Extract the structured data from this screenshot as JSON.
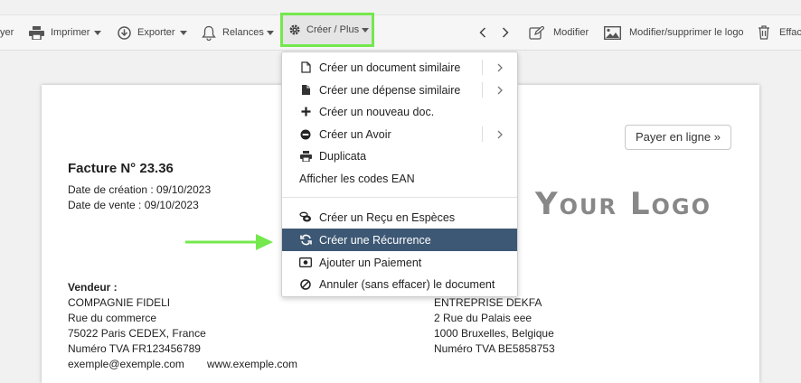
{
  "toolbar": {
    "payer_partial": "yer",
    "imprimer": "Imprimer",
    "exporter": "Exporter",
    "relances": "Relances",
    "creer_plus": "Créer / Plus",
    "modifier": "Modifier",
    "logo_action": "Modifier/supprimer le logo",
    "effacer_partial": "Effac"
  },
  "document": {
    "pay_online": "Payer en ligne »",
    "logo_text": "Your Logo",
    "invoice_title": "Facture N° 23.36",
    "creation_date": "Date de création : 09/10/2023",
    "sale_date": "Date de vente : 09/10/2023",
    "seller_label": "Vendeur :",
    "seller_lines": [
      "COMPAGNIE FIDELI",
      "Rue du commerce",
      "75022 Paris CEDEX, France",
      "Numéro TVA FR123456789"
    ],
    "seller_email": "exemple@exemple.com",
    "seller_web": "www.exemple.com",
    "buyer_lines": [
      "ENTREPRISE DEKFA",
      "2 Rue du Palais eee",
      "1000 Bruxelles, Belgique",
      "Numéro TVA BE5858753"
    ]
  },
  "menu": {
    "items": [
      {
        "label": "Créer un document similaire",
        "icon": "document-icon",
        "submenu": true
      },
      {
        "label": "Créer une dépense similaire",
        "icon": "document-filled-icon",
        "submenu": true
      },
      {
        "label": "Créer un nouveau doc.",
        "icon": "plus-icon",
        "submenu": false
      },
      {
        "label": "Créer un Avoir",
        "icon": "minus-circle-icon",
        "submenu": true
      },
      {
        "label": "Duplicata",
        "icon": "print-icon",
        "submenu": false
      },
      {
        "label": "Afficher les codes EAN",
        "icon": "",
        "submenu": false
      },
      {
        "label": "Créer un Reçu en Espèces",
        "icon": "coins-icon",
        "submenu": false
      },
      {
        "label": "Créer une Récurrence",
        "icon": "sync-icon",
        "submenu": false,
        "active": true
      },
      {
        "label": "Ajouter un Paiement",
        "icon": "cash-icon",
        "submenu": false
      },
      {
        "label": "Annuler (sans effacer) le document",
        "icon": "ban-icon",
        "submenu": false
      }
    ]
  },
  "colors": {
    "highlight_border": "#74e84d",
    "menu_active": "#3d5874",
    "annotation_arrow": "#74e84d"
  }
}
